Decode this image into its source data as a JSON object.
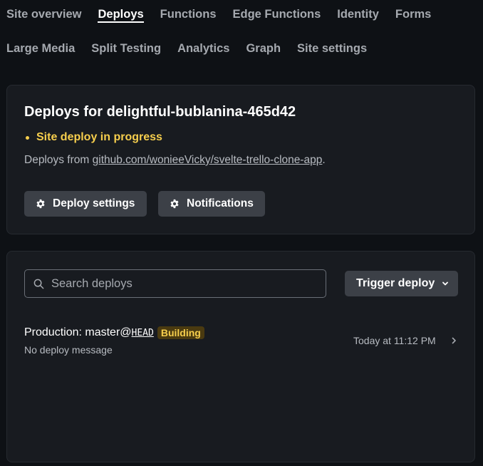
{
  "nav": {
    "row1": [
      "Site overview",
      "Deploys",
      "Functions",
      "Edge Functions",
      "Identity",
      "Forms"
    ],
    "row2": [
      "Large Media",
      "Split Testing",
      "Analytics",
      "Graph",
      "Site settings"
    ],
    "active": "Deploys"
  },
  "deploys_card": {
    "title": "Deploys for delightful-bublanina-465d42",
    "status": "Site deploy in progress",
    "source_prefix": "Deploys from ",
    "source_link": "github.com/wonieeVicky/svelte-trello-clone-app",
    "source_suffix": ".",
    "deploy_settings_label": "Deploy settings",
    "notifications_label": "Notifications"
  },
  "list_card": {
    "search_placeholder": "Search deploys",
    "trigger_label": "Trigger deploy",
    "deploy": {
      "title_prefix": "Production: master@",
      "ref": "HEAD",
      "badge": "Building",
      "message": "No deploy message",
      "time": "Today at 11:12 PM"
    }
  },
  "colors": {
    "background": "#0e1115",
    "card": "#181b20",
    "button": "#3c4047",
    "accent_yellow": "#f6ce4d"
  },
  "icons": {
    "deploy_settings": "gear-icon",
    "notifications": "gear-icon",
    "search": "search-icon",
    "trigger": "chevron-down-icon",
    "row": "chevron-right-icon"
  }
}
